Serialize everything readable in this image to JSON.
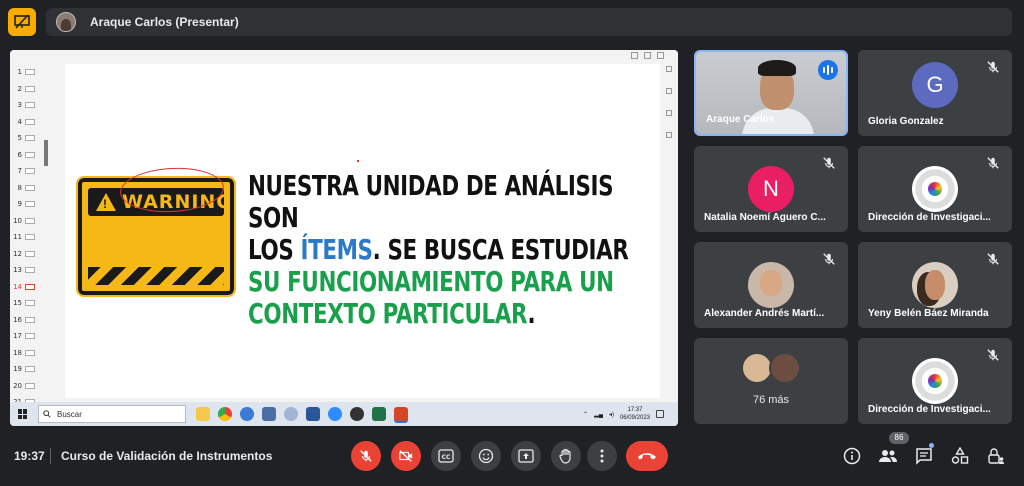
{
  "presenter": {
    "name": "Araque Carlos (Presentar)"
  },
  "slide": {
    "line1": "NUESTRA UNIDAD DE ANÁLISIS SON",
    "line2_a": "LOS ",
    "line2_b": "ÍTEMS",
    "line2_c": ". SE BUSCA ESTUDIAR",
    "line3": "SU FUNCIONAMIENTO PARA UN",
    "line4_a": "CONTEXTO PARTICULAR",
    "line4_b": ".",
    "warning_label": "WARNING",
    "active_slide": "14"
  },
  "thumbnails": [
    "1",
    "2",
    "3",
    "4",
    "5",
    "6",
    "7",
    "8",
    "9",
    "10",
    "11",
    "12",
    "13",
    "14",
    "15",
    "16",
    "17",
    "18",
    "19",
    "20",
    "21"
  ],
  "taskbar": {
    "search_placeholder": "Buscar",
    "clock_time": "17:37",
    "clock_date": "06/09/2023"
  },
  "participants": [
    {
      "name": "Araque Carlos",
      "speaking": true
    },
    {
      "name": "Gloria Gonzalez",
      "initial": "G",
      "color": "#5c6bc0"
    },
    {
      "name": "Natalia Noemí Aguero C...",
      "initial": "N",
      "color": "#e91e63"
    },
    {
      "name": "Dirección de Investigaci..."
    },
    {
      "name": "Alexander Andrés Martí..."
    },
    {
      "name": "Yeny Belén Báez Miranda"
    },
    {
      "more": "76 más"
    },
    {
      "name": "Dirección de Investigaci..."
    }
  ],
  "bottom": {
    "time": "19:37",
    "title": "Curso de Validación de Instrumentos",
    "people_count": "86"
  },
  "colors": {
    "background": "#202124",
    "tile": "#3c4043",
    "danger": "#ea4335",
    "accent_blue": "#8ab4f8"
  }
}
